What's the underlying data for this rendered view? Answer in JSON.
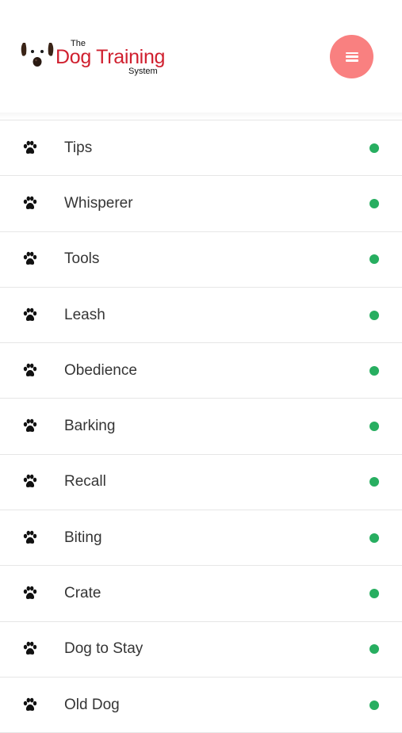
{
  "header": {
    "logo": {
      "line_top": "The",
      "line_main": "Dog Training",
      "line_bottom": "System"
    },
    "menu_button": {
      "icon": "hamburger-icon",
      "color": "#f98080"
    }
  },
  "menu": {
    "item_icon": "paw-icon",
    "status_color": "#27ae60",
    "items": [
      {
        "label": "Tips"
      },
      {
        "label": "Whisperer"
      },
      {
        "label": "Tools"
      },
      {
        "label": "Leash"
      },
      {
        "label": "Obedience"
      },
      {
        "label": "Barking"
      },
      {
        "label": "Recall"
      },
      {
        "label": "Biting"
      },
      {
        "label": "Crate"
      },
      {
        "label": "Dog to Stay"
      },
      {
        "label": "Old Dog"
      }
    ]
  },
  "colors": {
    "brand_red": "#d0202f",
    "accent": "#f98080",
    "status_green": "#27ae60"
  }
}
